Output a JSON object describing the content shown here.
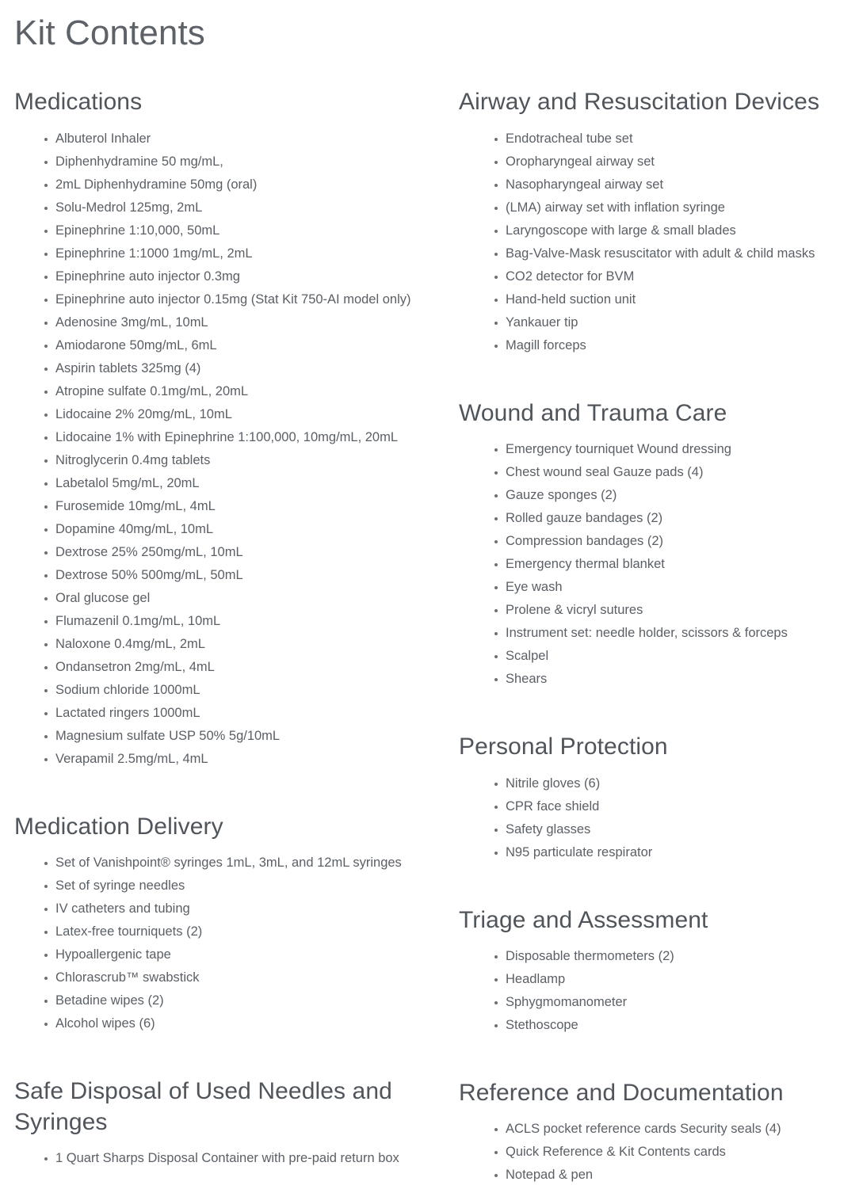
{
  "page": {
    "title": "Kit Contents"
  },
  "colors": {
    "background": "#ffffff",
    "title_text": "#5d6268",
    "heading_text": "#50555c",
    "body_text": "#5b6066",
    "bullet": "#6c7178"
  },
  "left_column": {
    "sections": [
      {
        "heading": "Medications",
        "items": [
          "Albuterol Inhaler",
          "Diphenhydramine 50 mg/mL,",
          "2mL Diphenhydramine 50mg (oral)",
          "Solu-Medrol 125mg, 2mL",
          "Epinephrine 1:10,000, 50mL",
          "Epinephrine 1:1000 1mg/mL, 2mL",
          "Epinephrine auto injector 0.3mg",
          "Epinephrine auto injector 0.15mg (Stat Kit 750-AI model only)",
          "Adenosine 3mg/mL, 10mL",
          "Amiodarone 50mg/mL, 6mL",
          "Aspirin tablets 325mg (4)",
          "Atropine sulfate 0.1mg/mL, 20mL",
          "Lidocaine 2% 20mg/mL, 10mL",
          "Lidocaine 1% with Epinephrine 1:100,000, 10mg/mL, 20mL",
          "Nitroglycerin 0.4mg tablets",
          "Labetalol 5mg/mL, 20mL",
          "Furosemide 10mg/mL, 4mL",
          "Dopamine 40mg/mL, 10mL",
          "Dextrose 25% 250mg/mL, 10mL",
          "Dextrose 50% 500mg/mL, 50mL",
          "Oral glucose gel",
          "Flumazenil 0.1mg/mL, 10mL",
          "Naloxone 0.4mg/mL, 2mL",
          "Ondansetron 2mg/mL, 4mL",
          "Sodium chloride 1000mL",
          "Lactated ringers 1000mL",
          "Magnesium sulfate USP 50% 5g/10mL",
          "Verapamil 2.5mg/mL, 4mL"
        ]
      },
      {
        "heading": "Medication Delivery",
        "items": [
          "Set of Vanishpoint® syringes 1mL, 3mL, and 12mL syringes",
          "Set of syringe needles",
          "IV catheters and tubing",
          "Latex-free tourniquets (2)",
          "Hypoallergenic tape",
          "Chlorascrub™ swabstick",
          "Betadine wipes (2)",
          "Alcohol wipes (6)"
        ]
      },
      {
        "heading": "Safe Disposal of Used Needles and Syringes",
        "items": [
          "1 Quart Sharps Disposal Container with pre-paid return box"
        ]
      }
    ]
  },
  "right_column": {
    "sections": [
      {
        "heading": "Airway and Resuscitation Devices",
        "items": [
          "Endotracheal tube set",
          "Oropharyngeal airway set",
          "Nasopharyngeal airway set",
          "(LMA) airway set with inflation syringe",
          "Laryngoscope with large & small blades",
          "Bag-Valve-Mask resuscitator with adult & child masks",
          "CO2 detector for BVM",
          "Hand-held suction unit",
          "Yankauer tip",
          "Magill forceps"
        ]
      },
      {
        "heading": "Wound and Trauma Care",
        "items": [
          "Emergency tourniquet Wound dressing",
          "Chest wound seal Gauze pads (4)",
          "Gauze sponges (2)",
          "Rolled gauze bandages (2)",
          "Compression bandages (2)",
          "Emergency thermal blanket",
          "Eye wash",
          "Prolene & vicryl sutures",
          "Instrument set: needle holder, scissors & forceps",
          "Scalpel",
          "Shears"
        ]
      },
      {
        "heading": "Personal Protection",
        "items": [
          "Nitrile gloves (6)",
          "CPR face shield",
          "Safety glasses",
          "N95 particulate respirator"
        ]
      },
      {
        "heading": "Triage and Assessment",
        "items": [
          "Disposable thermometers (2)",
          "Headlamp",
          "Sphygmomanometer",
          "Stethoscope"
        ]
      },
      {
        "heading": "Reference and Documentation",
        "items": [
          "ACLS pocket reference cards Security seals (4)",
          "Quick Reference & Kit Contents cards",
          "Notepad & pen"
        ]
      }
    ]
  }
}
